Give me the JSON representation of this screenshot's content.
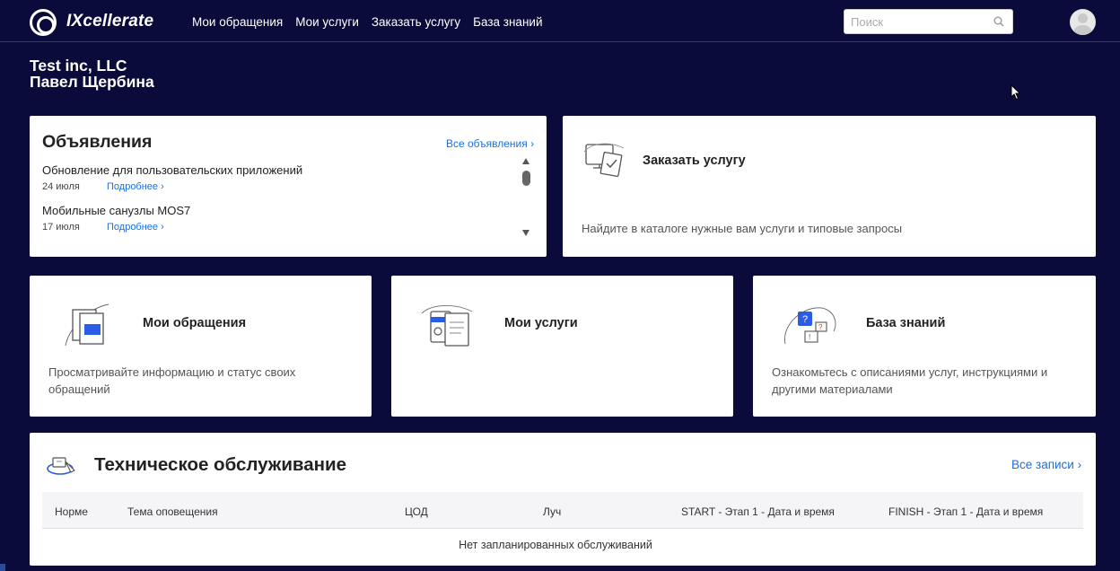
{
  "header": {
    "brand": "IXcellerate",
    "nav": [
      "Мои обращения",
      "Мои услуги",
      "Заказать услугу",
      "База знаний"
    ],
    "search_placeholder": "Поиск"
  },
  "company": {
    "name": "Test inc, LLC",
    "user": "Павел Щербина"
  },
  "announcements": {
    "title": "Объявления",
    "all_link": "Все объявления",
    "items": [
      {
        "title": "Обновление для пользовательских приложений",
        "date": "24 июля",
        "more": "Подробнее"
      },
      {
        "title": "Мобильные санузлы MOS7",
        "date": "17 июля",
        "more": "Подробнее"
      }
    ]
  },
  "order": {
    "title": "Заказать услугу",
    "description": "Найдите в каталоге нужные вам услуги и типовые запросы"
  },
  "tiles": [
    {
      "title": "Мои обращения",
      "description": "Просматривайте информацию и статус своих обращений"
    },
    {
      "title": "Мои услуги",
      "description": ""
    },
    {
      "title": "База знаний",
      "description": "Ознакомьтесь с описаниями услуг, инструкциями и другими материалами"
    }
  ],
  "maintenance": {
    "title": "Техническое обслуживание",
    "all_link": "Все записи",
    "columns": [
      "Норме",
      "Тема оповещения",
      "ЦОД",
      "Луч",
      "START - Этап 1 - Дата и время",
      "FINISH - Этап 1 - Дата и время"
    ],
    "empty_text": "Нет запланированных обслуживаний"
  },
  "colors": {
    "background": "#0b0b3b",
    "accent": "#1e6fd9",
    "card": "#ffffff"
  },
  "icons": [
    "logo-icon",
    "search-icon",
    "avatar-icon",
    "chevron-right-icon",
    "cursor-icon"
  ]
}
